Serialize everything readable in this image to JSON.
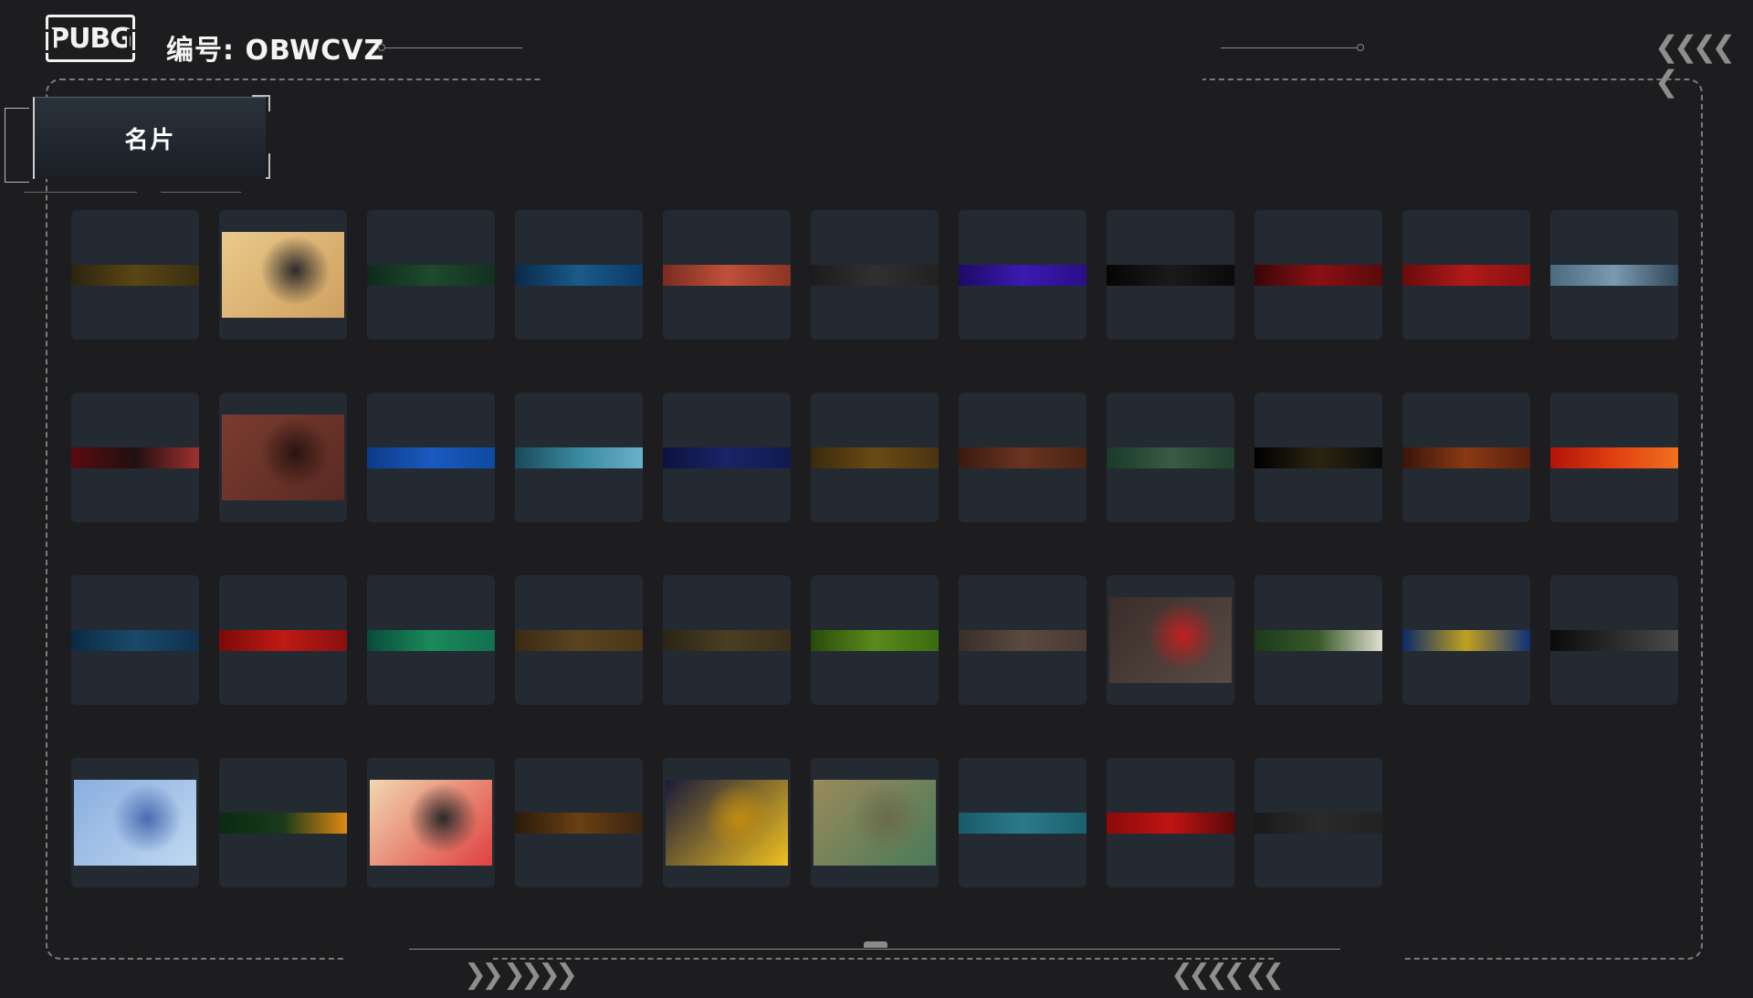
{
  "header": {
    "logo_text": "PUBG",
    "id_label": "编号",
    "id_separator": ":",
    "id_value": "OBWCVZ"
  },
  "tab": {
    "label": "名片"
  },
  "decor": {
    "top_right_chevrons": "❮❮❮❮ ❮",
    "bottom_left_chevrons": "❯❯ ❯❯❯❯",
    "bottom_right_chevrons": "❮❮❮❮ ❮❮"
  },
  "cards": [
    {
      "kind": "strip",
      "colors": [
        "#2b2410",
        "#5a4614",
        "#3a2f12"
      ]
    },
    {
      "kind": "image",
      "colors": [
        "#e9c98a",
        "#cfa060",
        "#2d2a2a"
      ],
      "icon": "tiger-illustration-icon"
    },
    {
      "kind": "strip",
      "colors": [
        "#0f2a1c",
        "#1e4a2c",
        "#123020"
      ]
    },
    {
      "kind": "strip",
      "colors": [
        "#0a2a4a",
        "#1a5a8a",
        "#0c3a66"
      ]
    },
    {
      "kind": "strip",
      "colors": [
        "#7a2c20",
        "#c0503a",
        "#8a3424"
      ]
    },
    {
      "kind": "strip",
      "colors": [
        "#1c1c1c",
        "#303030",
        "#222222"
      ]
    },
    {
      "kind": "strip",
      "colors": [
        "#1e0a66",
        "#3a1ab0",
        "#2a0e88"
      ]
    },
    {
      "kind": "strip",
      "colors": [
        "#050505",
        "#1a1a1a",
        "#0a0a0a"
      ]
    },
    {
      "kind": "strip",
      "colors": [
        "#3a0608",
        "#8a1014",
        "#5a0a0c"
      ]
    },
    {
      "kind": "strip",
      "colors": [
        "#6a0a0c",
        "#b01a1a",
        "#8a1010"
      ]
    },
    {
      "kind": "strip",
      "colors": [
        "#4a6a7e",
        "#7a9ab0",
        "#33475a"
      ]
    },
    {
      "kind": "strip",
      "colors": [
        "#5a0a10",
        "#201010",
        "#a03030"
      ]
    },
    {
      "kind": "image",
      "colors": [
        "#7a3c30",
        "#5a2a22",
        "#2a1410"
      ],
      "icon": "wolf-illustration-icon"
    },
    {
      "kind": "strip",
      "colors": [
        "#0c3a8a",
        "#1a5ac0",
        "#0e4aa0"
      ]
    },
    {
      "kind": "strip",
      "colors": [
        "#1a4a5a",
        "#3a8aa0",
        "#6ab0c8"
      ]
    },
    {
      "kind": "strip",
      "colors": [
        "#0c1240",
        "#1a2466",
        "#101a50"
      ]
    },
    {
      "kind": "strip",
      "colors": [
        "#3a2a0c",
        "#6a4a14",
        "#4a3410"
      ]
    },
    {
      "kind": "strip",
      "colors": [
        "#3a1a10",
        "#6a3420",
        "#4a2414"
      ]
    },
    {
      "kind": "strip",
      "colors": [
        "#1a3a2a",
        "#3a5a44",
        "#22402e"
      ]
    },
    {
      "kind": "strip",
      "colors": [
        "#000000",
        "#2a2410",
        "#0a0a0a"
      ]
    },
    {
      "kind": "strip",
      "colors": [
        "#3a140a",
        "#8a3a14",
        "#5a200c"
      ]
    },
    {
      "kind": "strip",
      "colors": [
        "#b0140a",
        "#e04010",
        "#f07020"
      ]
    },
    {
      "kind": "strip",
      "colors": [
        "#0a2a44",
        "#1a4a6a",
        "#10304e"
      ]
    },
    {
      "kind": "strip",
      "colors": [
        "#7a0a0a",
        "#c01a14",
        "#8a1010"
      ]
    },
    {
      "kind": "strip",
      "colors": [
        "#0a4a3a",
        "#1a8a5a",
        "#127050"
      ]
    },
    {
      "kind": "strip",
      "colors": [
        "#3a2a14",
        "#5a4420",
        "#4a3618"
      ]
    },
    {
      "kind": "strip",
      "colors": [
        "#2a2414",
        "#4a3e22",
        "#3a301a"
      ]
    },
    {
      "kind": "strip",
      "colors": [
        "#2a4a0c",
        "#5a8a1a",
        "#3a6a10"
      ]
    },
    {
      "kind": "strip",
      "colors": [
        "#3a2e2a",
        "#5a4a40",
        "#4a3a34"
      ]
    },
    {
      "kind": "image",
      "colors": [
        "#3a2e2a",
        "#5a4a44",
        "#c02020"
      ],
      "icon": "plague-doctor-illustration-icon"
    },
    {
      "kind": "strip",
      "colors": [
        "#1a3a1a",
        "#3a5a2a",
        "#e0e0d0"
      ]
    },
    {
      "kind": "strip",
      "colors": [
        "#0a2a6a",
        "#c0a020",
        "#10307a"
      ]
    },
    {
      "kind": "strip",
      "colors": [
        "#0a0a0a",
        "#2a2a2a",
        "#4a4a4a"
      ]
    },
    {
      "kind": "image",
      "colors": [
        "#8aaee0",
        "#c0d8f0",
        "#4a6ab0"
      ],
      "icon": "winter-village-illustration-icon"
    },
    {
      "kind": "strip",
      "colors": [
        "#0a2a14",
        "#1a3a1a",
        "#e08a10"
      ]
    },
    {
      "kind": "image",
      "colors": [
        "#f0d8b0",
        "#e04040",
        "#2a2a2a"
      ],
      "icon": "red-goggles-illustration-icon"
    },
    {
      "kind": "strip",
      "colors": [
        "#2a1a0a",
        "#6a4014",
        "#3a2410"
      ]
    },
    {
      "kind": "image",
      "colors": [
        "#1a1a3a",
        "#f0c020",
        "#c08a10"
      ],
      "icon": "gold-number-eight-icon"
    },
    {
      "kind": "image",
      "colors": [
        "#9a8a5a",
        "#4a7a5a",
        "#6a6a4a"
      ],
      "icon": "frog-knight-illustration-icon"
    },
    {
      "kind": "strip",
      "colors": [
        "#1a5a6a",
        "#2a7a8a",
        "#1a6070"
      ]
    },
    {
      "kind": "strip",
      "colors": [
        "#8a0a0a",
        "#c01414",
        "#5a0808"
      ]
    },
    {
      "kind": "strip",
      "colors": [
        "#1a1a1a",
        "#2a2a2a",
        "#222222"
      ]
    }
  ]
}
